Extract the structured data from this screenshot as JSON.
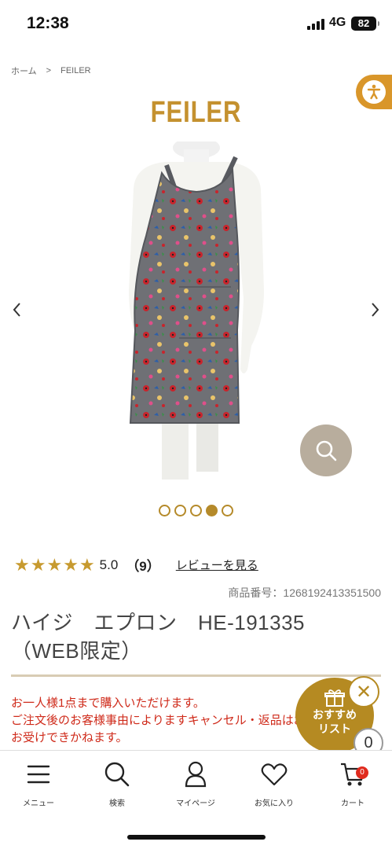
{
  "status_bar": {
    "time": "12:38",
    "network": "4G",
    "battery": "82"
  },
  "breadcrumb": {
    "home": "ホーム",
    "separator": ">",
    "current": "FEILER"
  },
  "brand": {
    "logo_text": "FEILER",
    "accent_color": "#c4912f"
  },
  "carousel": {
    "dot_count": 5,
    "active_index": 3
  },
  "rating": {
    "stars": 5,
    "score": "5.0",
    "count": "（9）",
    "review_link": "レビューを見る"
  },
  "product": {
    "code": "商品番号：1268192413351500",
    "title": "ハイジ　エプロン　HE-191335\n（WEB限定）"
  },
  "notice": {
    "line1": "お一人様1点まで購入いただけます。",
    "line2": "ご注文後のお客様事由によりますキャンセル・返品はお受けできかねます。",
    "line3": "お受けできかねます。"
  },
  "recommend": {
    "label_line1": "おすすめ",
    "label_line2": "リスト",
    "count": "0"
  },
  "bottom_nav": {
    "menu": "メニュー",
    "search": "検索",
    "mypage": "マイページ",
    "favorites": "お気に入り",
    "cart": "カート",
    "cart_count": "0"
  }
}
